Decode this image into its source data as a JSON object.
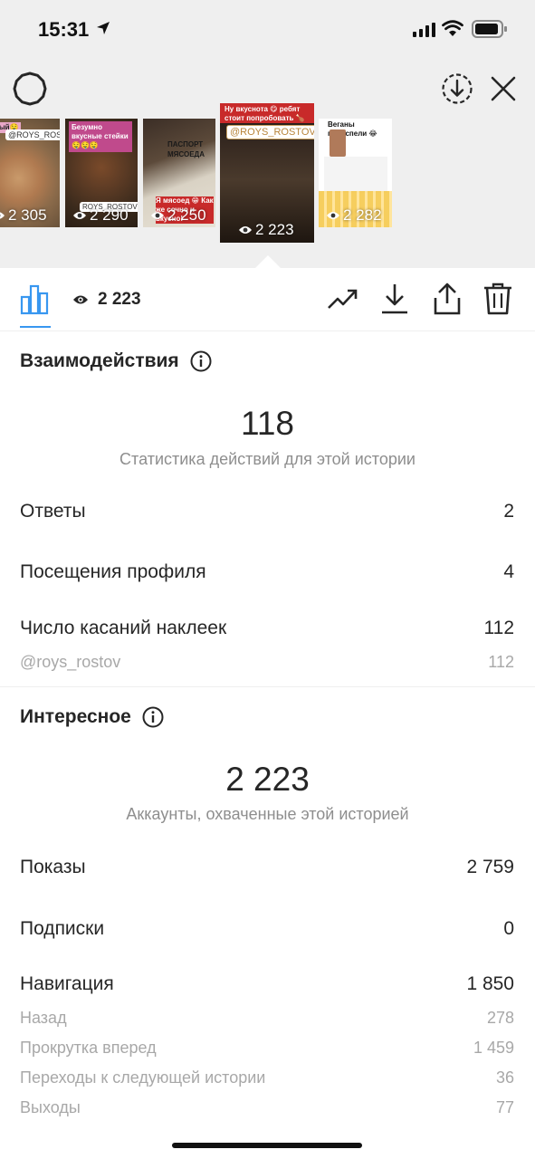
{
  "status_bar": {
    "time": "15:31"
  },
  "stories": [
    {
      "views": "2 305",
      "caption": "ный🤤",
      "tag": "@ROYS_ROSTOV"
    },
    {
      "views": "2 290",
      "caption": "Безумно вкусные стейки🤤🤤🤤",
      "tag": "ROYS_ROSTOV"
    },
    {
      "views": "2 250",
      "caption": "Я мясоед 😁 Как же сочно и вкусно!",
      "tag": "ПАСПОРТ МЯСОЕДА"
    },
    {
      "views": "2 223",
      "caption": "Ну вкуснота 😋 ребят стоит попробовать 🍗",
      "tag": "@ROYS_ROSTOV"
    },
    {
      "views": "2 282",
      "caption": "Веганы подоспели 😂",
      "tag": ""
    }
  ],
  "toolbar": {
    "views": "2 223"
  },
  "interactions": {
    "title": "Взаимодействия",
    "total": "118",
    "subtitle": "Статистика действий для этой истории",
    "rows": [
      {
        "label": "Ответы",
        "value": "2"
      },
      {
        "label": "Посещения профиля",
        "value": "4"
      },
      {
        "label": "Число касаний наклеек",
        "value": "112"
      }
    ],
    "sticker": {
      "label": "@roys_rostov",
      "value": "112"
    }
  },
  "discovery": {
    "title": "Интересное",
    "total": "2 223",
    "subtitle": "Аккаунты, охваченные этой историей",
    "rows": [
      {
        "label": "Показы",
        "value": "2 759"
      },
      {
        "label": "Подписки",
        "value": "0"
      },
      {
        "label": "Навигация",
        "value": "1 850"
      }
    ],
    "nav": [
      {
        "label": "Назад",
        "value": "278"
      },
      {
        "label": "Прокрутка вперед",
        "value": "1 459"
      },
      {
        "label": "Переходы к следующей истории",
        "value": "36"
      },
      {
        "label": "Выходы",
        "value": "77"
      }
    ]
  },
  "colors": {
    "accent": "#3897f0",
    "text": "#262626",
    "muted": "#8e8e8e",
    "faint": "#a8a8a8",
    "story_red": "#c82a2a"
  },
  "icons": [
    "location-arrow-icon",
    "signal-icon",
    "wifi-icon",
    "battery-icon",
    "gear-icon",
    "download-circle-icon",
    "close-icon",
    "eye-icon",
    "bar-chart-icon",
    "trend-icon",
    "download-icon",
    "share-icon",
    "trash-icon",
    "info-icon"
  ]
}
